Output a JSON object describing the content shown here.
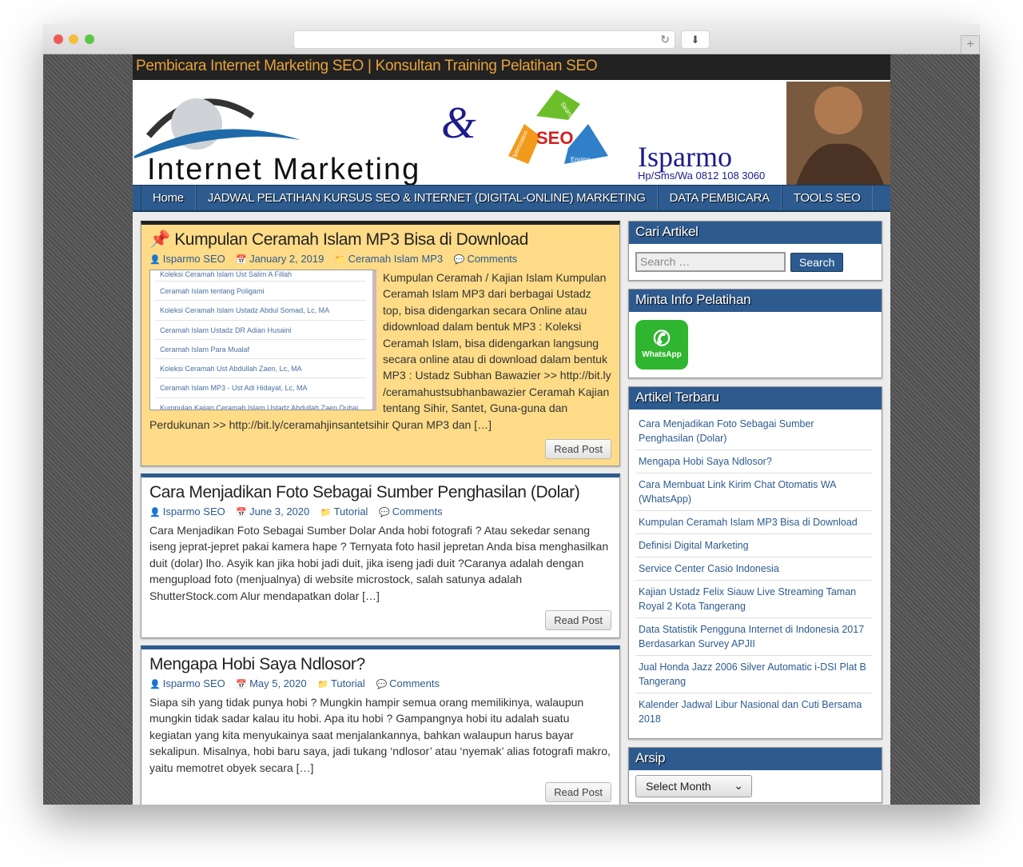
{
  "site": {
    "title": "Pembicara Internet Marketing SEO | Konsultan Training Pelatihan SEO",
    "banner": {
      "logo_text": "Internet Marketing",
      "amp": "&",
      "seo": "SEO",
      "seo_words": [
        "Search",
        "Engine",
        "Optimization"
      ],
      "name": "Isparmo",
      "phone": "Hp/Sms/Wa 0812 108 3060"
    }
  },
  "nav": [
    "Home",
    "JADWAL PELATIHAN KURSUS SEO & INTERNET (DIGITAL-ONLINE) MARKETING",
    "DATA PEMBICARA",
    "TOOLS SEO"
  ],
  "posts": [
    {
      "title": "Kumpulan Ceramah Islam MP3 Bisa di Download",
      "author": "Isparmo SEO",
      "date": "January 2, 2019",
      "category": "Ceramah Islam MP3",
      "comments": "Comments",
      "thumb_items": [
        "Koleksi Ceramah Islam Ust Salim A Fillah",
        "Ceramah Islam tentang Poligami",
        "Koleksi Ceramah Islam Ustadz Abdul Somad, Lc, MA",
        "Ceramah Islam Ustadz DR Adian Husaini",
        "Ceramah Islam Para Mualaf",
        "Koleksi Ceramah Ust Abdullah Zaen, Lc, MA",
        "Ceramah Islam MP3 - Ust Adi Hidayat, Lc, MA",
        "Kumpulan Kajian Ceramah Islam Ustadz Abdullah Zaen Dubai"
      ],
      "excerpt": "Kumpulan Ceramah / Kajian Islam Kumpulan Ceramah Islam MP3 dari berbagai Ustadz top, bisa didengarkan secara Online atau didownload dalam bentuk MP3 : Koleksi Ceramah Islam, bisa didengarkan langsung secara online atau di download dalam bentuk MP3 : Ustadz Subhan Bawazier >> http://bit.ly /ceramahustsubhanbawazier Ceramah Kajian tentang Sihir, Santet, Guna-guna dan Perdukunan >> http://bit.ly/ceramahjinsantetsihir Quran MP3 dan […]",
      "read": "Read Post"
    },
    {
      "title": "Cara Menjadikan Foto Sebagai Sumber Penghasilan (Dolar)",
      "author": "Isparmo SEO",
      "date": "June 3, 2020",
      "category": "Tutorial",
      "comments": "Comments",
      "excerpt": "Cara Menjadikan Foto Sebagai Sumber Dolar Anda hobi fotografi ? Atau sekedar senang iseng jeprat-jepret pakai kamera hape ? Ternyata foto hasil jepretan Anda bisa menghasilkan duit (dolar) lho. Asyik kan jika hobi jadi duit, jika iseng jadi duit ?Caranya adalah dengan mengupload foto (menjualnya) di website microstock, salah satunya adalah ShutterStock.com Alur mendapatkan dolar […]",
      "read": "Read Post"
    },
    {
      "title": "Mengapa Hobi Saya Ndlosor?",
      "author": "Isparmo SEO",
      "date": "May 5, 2020",
      "category": "Tutorial",
      "comments": "Comments",
      "excerpt": "Siapa sih yang tidak punya hobi ? Mungkin hampir semua orang memilikinya, walaupun mungkin tidak sadar kalau itu hobi. Apa itu hobi ? Gampangnya hobi itu adalah suatu kegiatan yang kita menyukainya saat menjalankannya, bahkan walaupun harus bayar sekalipun. Misalnya, hobi baru saya, jadi tukang ‘ndlosor’ atau ‘nyemak’ alias fotografi makro, yaitu memotret obyek secara […]",
      "read": "Read Post"
    }
  ],
  "sidebar": {
    "search": {
      "title": "Cari Artikel",
      "placeholder": "Search …",
      "button": "Search"
    },
    "info": {
      "title": "Minta Info Pelatihan",
      "wa_label": "WhatsApp"
    },
    "recent": {
      "title": "Artikel Terbaru",
      "items": [
        "Cara Menjadikan Foto Sebagai Sumber Penghasilan (Dolar)",
        "Mengapa Hobi Saya Ndlosor?",
        "Cara Membuat Link Kirim Chat Otomatis WA (WhatsApp)",
        "Kumpulan Ceramah Islam MP3 Bisa di Download",
        "Definisi Digital Marketing",
        "Service Center Casio Indonesia",
        "Kajian Ustadz Felix Siauw Live Streaming Taman Royal 2 Kota Tangerang",
        "Data Statistik Pengguna Internet di Indonesia 2017 Berdasarkan Survey APJII",
        "Jual Honda Jazz 2006 Silver Automatic i-DSI Plat B Tangerang",
        "Kalender Jadwal Libur Nasional dan Cuti Bersama 2018"
      ]
    },
    "archive": {
      "title": "Arsip",
      "select": "Select Month"
    }
  },
  "colors": {
    "accent": "#2d5b8f",
    "sticky": "#fddb87",
    "title_text": "#e8a23a"
  }
}
